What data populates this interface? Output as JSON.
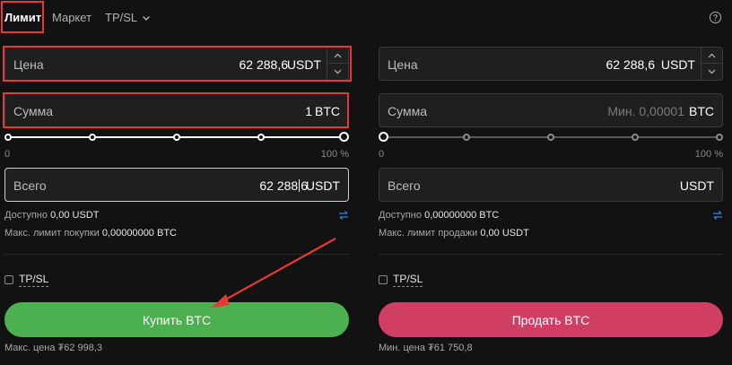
{
  "tabs": {
    "limit": "Лимит",
    "market": "Маркет",
    "tpsl": "TP/SL"
  },
  "buy": {
    "price_label": "Цена",
    "price_value": "62 288,6",
    "price_unit": "USDT",
    "amount_label": "Сумма",
    "amount_value": "1",
    "amount_unit": "BTC",
    "slider_min": "0",
    "slider_max": "100 %",
    "slider_percent": 100,
    "total_label": "Всего",
    "total_value_before_caret": "62 288",
    "total_value_after_caret": "6",
    "total_unit": "USDT",
    "available_label": "Доступно",
    "available_value": "0,00 USDT",
    "max_label": "Макс. лимит покупки",
    "max_value": "0,00000000 BTC",
    "tpsl_label": "TP/SL",
    "button_label": "Купить BTC",
    "price_note": "Макс. цена ₮62 998,3"
  },
  "sell": {
    "price_label": "Цена",
    "price_value": "62 288,6",
    "price_unit": "USDT",
    "amount_label": "Сумма",
    "amount_placeholder": "Мин. 0,00001",
    "amount_unit": "BTC",
    "slider_min": "0",
    "slider_max": "100 %",
    "slider_percent": 0,
    "total_label": "Всего",
    "total_unit": "USDT",
    "available_label": "Доступно",
    "available_value": "0,00000000 BTC",
    "max_label": "Макс. лимит продажи",
    "max_value": "0,00 USDT",
    "tpsl_label": "TP/SL",
    "button_label": "Продать BTC",
    "price_note": "Мин. цена ₮61 750,8"
  },
  "colors": {
    "buy": "#4caf50",
    "sell": "#d03e64",
    "annotation": "#e53935",
    "swap": "#3d7be0"
  },
  "icons": {
    "tpsl_dropdown": "chevron-down-icon",
    "help": "help-icon",
    "swap": "swap-icon",
    "stepper_up": "chevron-up-icon",
    "stepper_down": "chevron-down-icon"
  }
}
